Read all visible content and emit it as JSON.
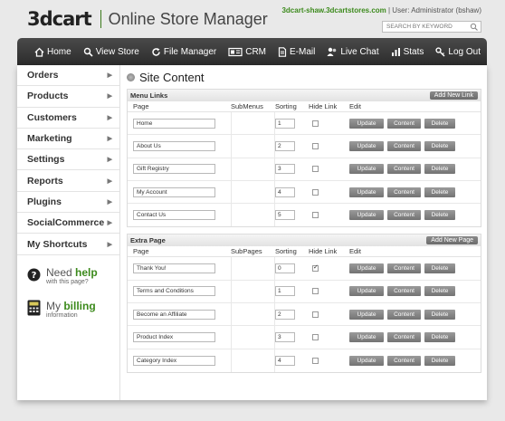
{
  "header": {
    "logo": "3dcart",
    "title": "Online Store Manager",
    "store_domain": "3dcart-shaw.3dcartstores.com",
    "user_text": " | User: Administrator (bshaw)",
    "search_placeholder": "SEARCH BY KEYWORD"
  },
  "nav": [
    {
      "label": "Home",
      "icon": "home-icon"
    },
    {
      "label": "View Store",
      "icon": "magnifier-icon"
    },
    {
      "label": "File Manager",
      "icon": "refresh-icon"
    },
    {
      "label": "CRM",
      "icon": "crm-icon"
    },
    {
      "label": "E-Mail",
      "icon": "document-icon"
    },
    {
      "label": "Live Chat",
      "icon": "chat-icon"
    },
    {
      "label": "Stats",
      "icon": "chart-icon"
    },
    {
      "label": "Log Out",
      "icon": "key-icon"
    }
  ],
  "sidebar": {
    "items": [
      "Orders",
      "Products",
      "Customers",
      "Marketing",
      "Settings",
      "Reports",
      "Plugins",
      "SocialCommerce",
      "My Shortcuts"
    ],
    "help": {
      "prefix": "Need ",
      "strong": "help",
      "sub": "with this page?"
    },
    "billing": {
      "prefix": "My ",
      "strong": "billing",
      "sub": "information"
    }
  },
  "page_title": "Site Content",
  "menu_links": {
    "title": "Menu Links",
    "add_label": "Add New Link",
    "columns": [
      "Page",
      "SubMenus",
      "Sorting",
      "Hide Link",
      "Edit"
    ],
    "rows": [
      {
        "page": "Home",
        "sort": "1",
        "hidden": false
      },
      {
        "page": "About Us",
        "sort": "2",
        "hidden": false
      },
      {
        "page": "Gift Registry",
        "sort": "3",
        "hidden": false
      },
      {
        "page": "My Account",
        "sort": "4",
        "hidden": false
      },
      {
        "page": "Contact Us",
        "sort": "5",
        "hidden": false
      }
    ]
  },
  "extra_page": {
    "title": "Extra Page",
    "add_label": "Add New Page",
    "columns": [
      "Page",
      "SubPages",
      "Sorting",
      "Hide Link",
      "Edit"
    ],
    "rows": [
      {
        "page": "Thank You!",
        "sort": "0",
        "hidden": true
      },
      {
        "page": "Terms and Conditions",
        "sort": "1",
        "hidden": false
      },
      {
        "page": "Become an Affiliate",
        "sort": "2",
        "hidden": false
      },
      {
        "page": "Product Index",
        "sort": "3",
        "hidden": false
      },
      {
        "page": "Category Index",
        "sort": "4",
        "hidden": false
      }
    ]
  },
  "edit_buttons": {
    "update": "Update",
    "content": "Content",
    "delete": "Delete"
  },
  "colors": {
    "accent_green": "#3c8a1c",
    "nav_dark": "#333333",
    "button_gray": "#808080"
  }
}
